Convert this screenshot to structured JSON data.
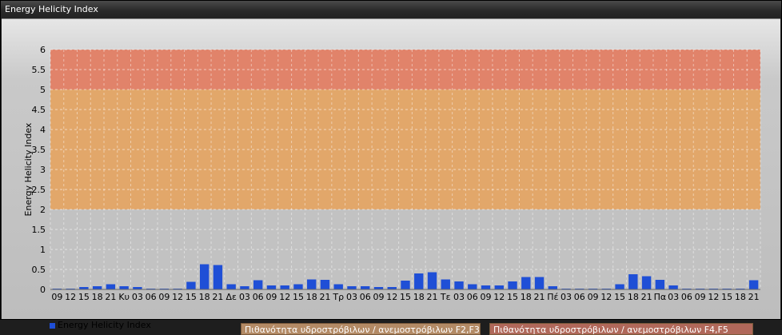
{
  "window": {
    "title": "Energy Helicity Index"
  },
  "legend": {
    "series_label": "Energy Helicity Index"
  },
  "bands": [
    {
      "label": "Πιθανότητα υδροστρόβιλων / ανεμοστρόβιλων F2,F3",
      "from": 2,
      "to": 5,
      "color": "#e8a25a"
    },
    {
      "label": "Πιθανότητα υδροστρόβιλων / ανεμοστρόβιλων F4,F5",
      "from": 5,
      "to": 6,
      "color": "#e6785a"
    }
  ],
  "chart_data": {
    "type": "bar",
    "ylabel": "Energy Helicity Index",
    "ylim": [
      0,
      6
    ],
    "yticks": [
      "0",
      "0.5",
      "1",
      "1.5",
      "2",
      "2.5",
      "3",
      "3.5",
      "4",
      "4.5",
      "5",
      "5.5",
      "6"
    ],
    "grid": true,
    "legend_position": "bottom-left",
    "bar_color": "#1f4fd6",
    "categories": [
      "09",
      "12",
      "15",
      "18",
      "21",
      "Κυ",
      "03",
      "06",
      "09",
      "12",
      "15",
      "18",
      "21",
      "Δε",
      "03",
      "06",
      "09",
      "12",
      "15",
      "18",
      "21",
      "Τρ",
      "03",
      "06",
      "09",
      "12",
      "15",
      "18",
      "21",
      "Τε",
      "03",
      "06",
      "09",
      "12",
      "15",
      "18",
      "21",
      "Πέ",
      "03",
      "06",
      "09",
      "12",
      "15",
      "18",
      "21",
      "Πα",
      "03",
      "06",
      "09",
      "12",
      "15",
      "18",
      "21"
    ],
    "values": [
      0.02,
      0.02,
      0.06,
      0.08,
      0.13,
      0.08,
      0.06,
      0.02,
      0.02,
      0.02,
      0.19,
      0.63,
      0.61,
      0.13,
      0.08,
      0.23,
      0.1,
      0.1,
      0.13,
      0.25,
      0.24,
      0.13,
      0.08,
      0.08,
      0.06,
      0.06,
      0.22,
      0.4,
      0.43,
      0.25,
      0.2,
      0.13,
      0.1,
      0.1,
      0.2,
      0.31,
      0.31,
      0.08,
      0.02,
      0.02,
      0.02,
      0.02,
      0.13,
      0.38,
      0.33,
      0.24,
      0.1,
      0.02,
      0.02,
      0.02,
      0.02,
      0.02,
      0.23
    ]
  }
}
